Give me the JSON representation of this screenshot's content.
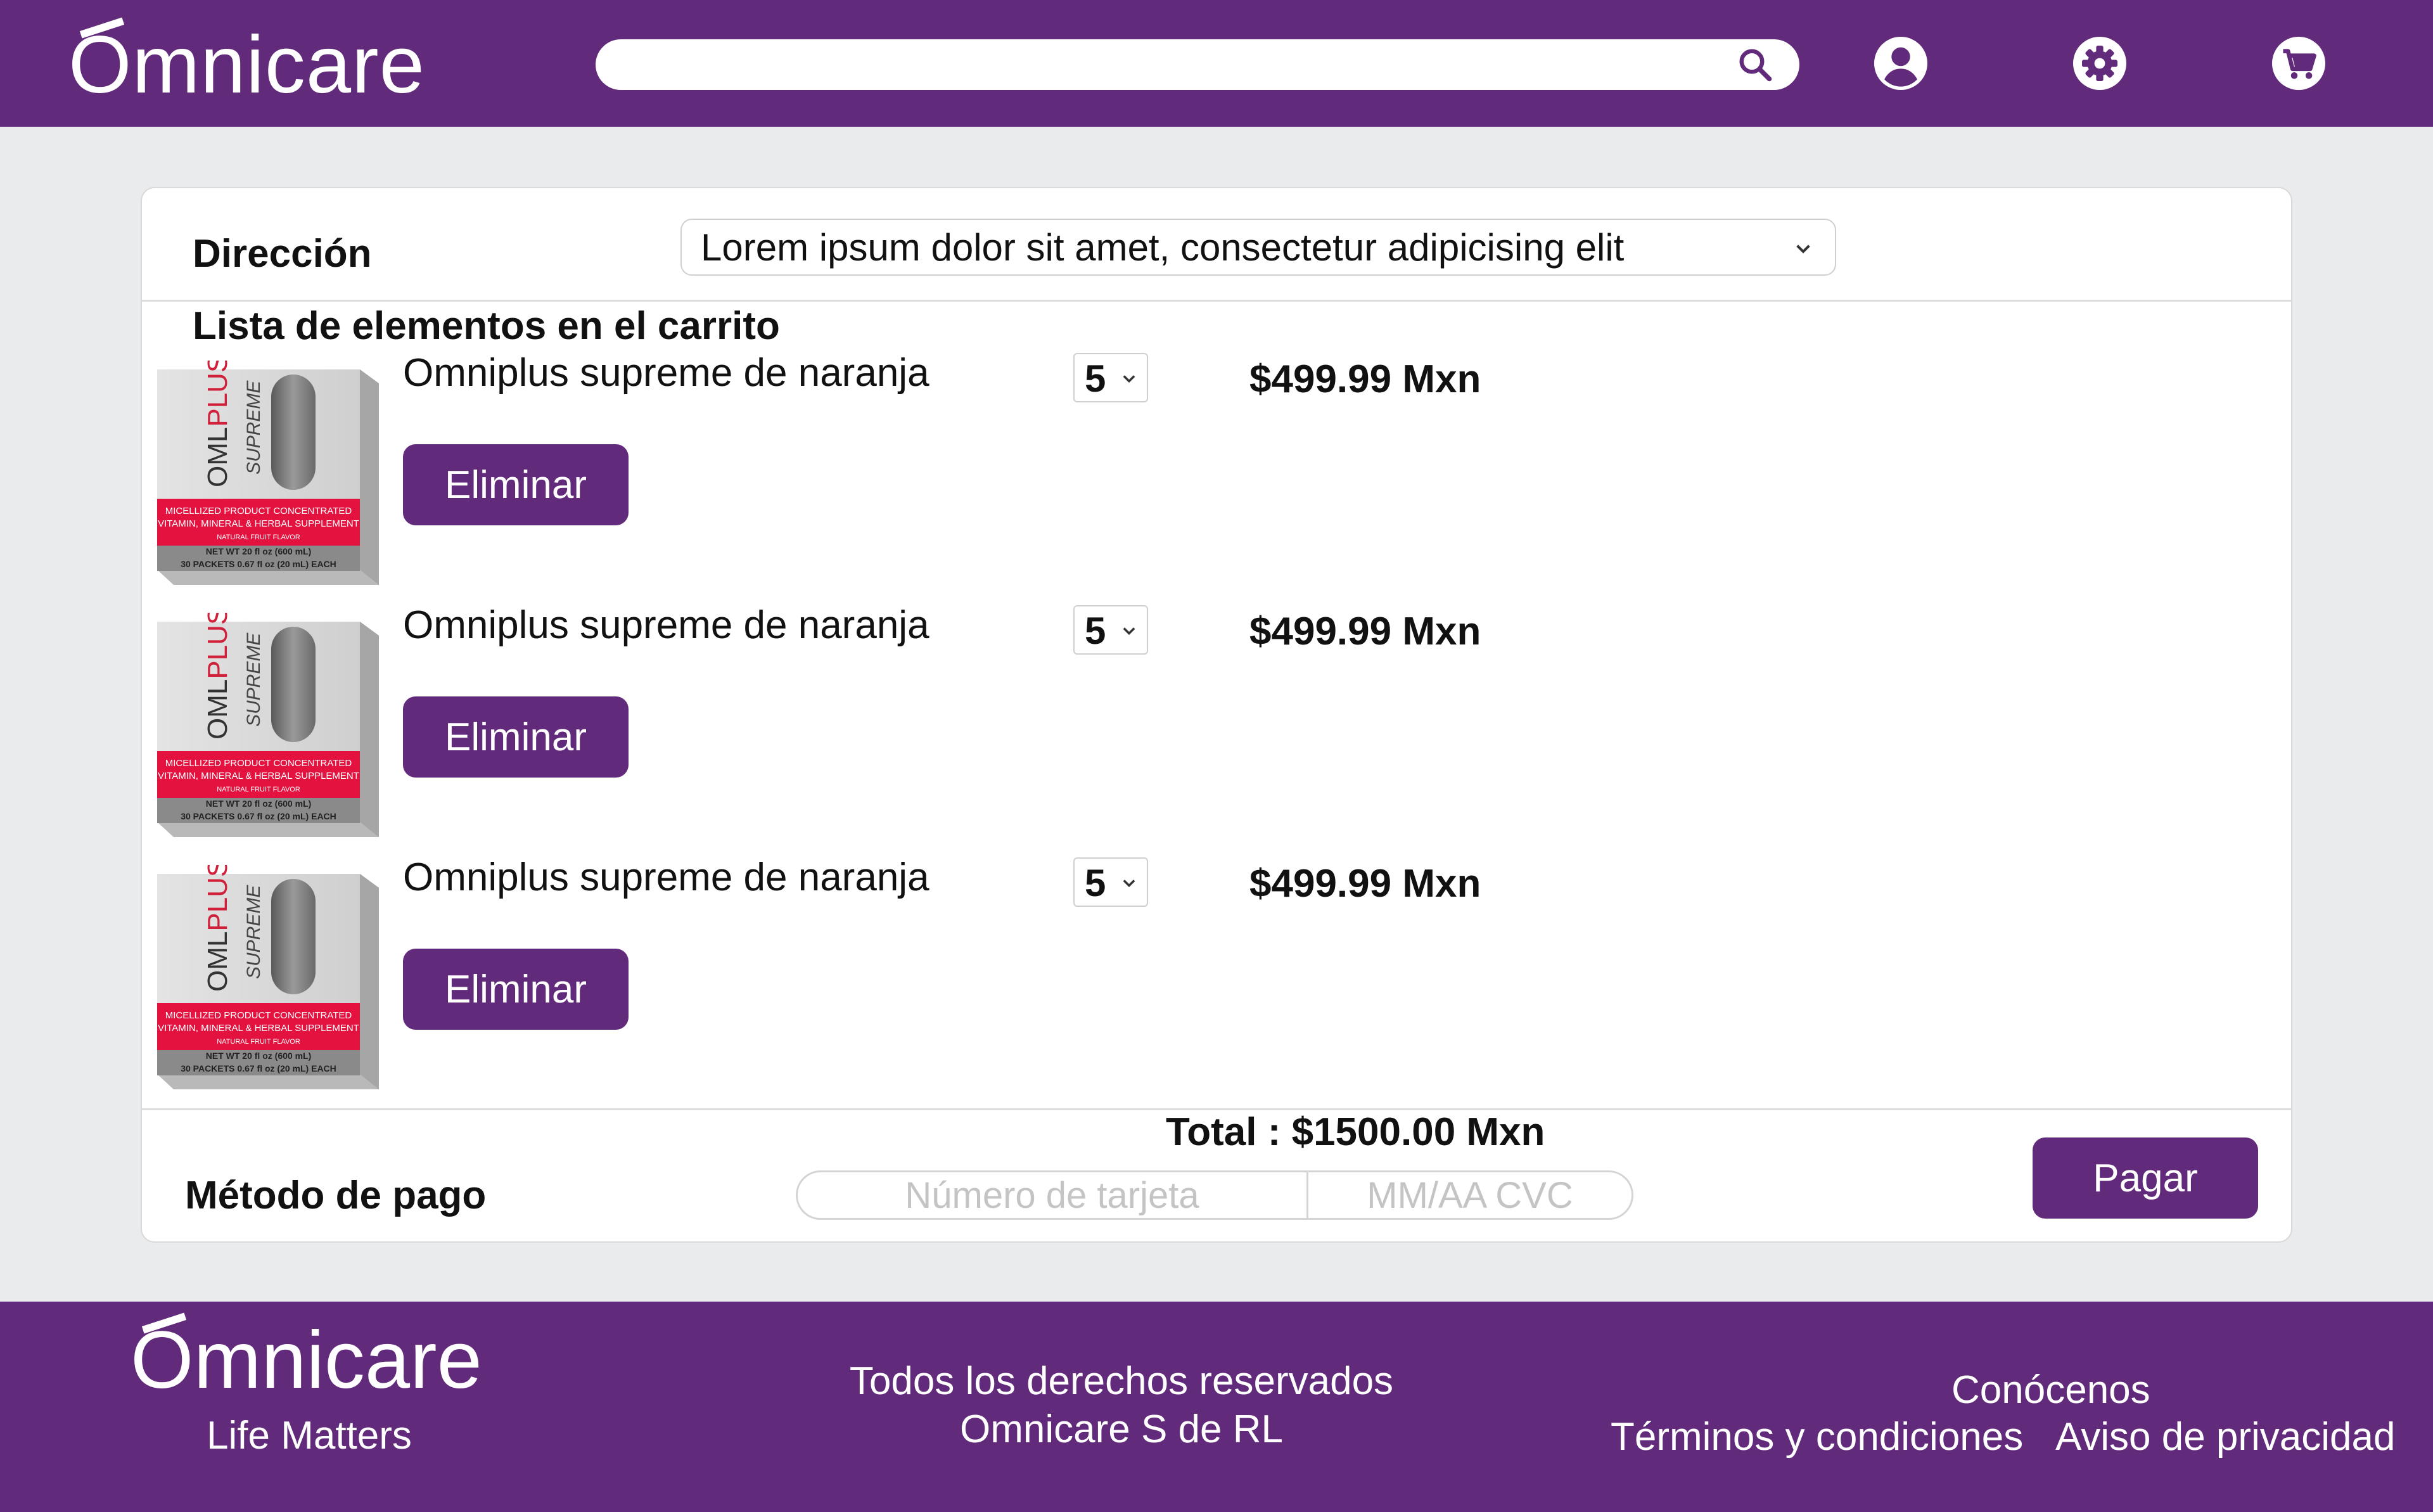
{
  "brand": {
    "logo_text": "mnicare",
    "primary_color": "#612a7b"
  },
  "header": {
    "search": {
      "placeholder": "",
      "icon": "search-icon"
    },
    "icons": [
      "user-icon",
      "gear-icon",
      "cart-icon"
    ]
  },
  "cart": {
    "address_label": "Dirección",
    "address_value": "Lorem ipsum dolor sit amet, consectetur adipicising elit",
    "list_title": "Lista de elementos en el carrito",
    "items": [
      {
        "name": "Omniplus supreme de naranja",
        "quantity": "5",
        "price": "$499.99 Mxn",
        "delete_label": "Eliminar"
      },
      {
        "name": "Omniplus supreme de naranja",
        "quantity": "5",
        "price": "$499.99 Mxn",
        "delete_label": "Eliminar"
      },
      {
        "name": "Omniplus supreme de naranja",
        "quantity": "5",
        "price": "$499.99 Mxn",
        "delete_label": "Eliminar"
      }
    ],
    "product_image": {
      "brand_left": "OML",
      "brand_right": "PLUS",
      "sub": "SUPREME",
      "band_line1": "MICELLIZED PRODUCT CONCENTRATED",
      "band_line2": "VITAMIN, MINERAL & HERBAL SUPPLEMENT",
      "band_line3": "NATURAL FRUIT FLAVOR",
      "net_line1": "NET WT 20 fl oz (600 mL)",
      "net_line2": "30 PACKETS 0.67 fl oz (20 mL) EACH"
    },
    "total": "Total : $1500.00 Mxn",
    "payment_label": "Método de pago",
    "card_number_placeholder": "Número de tarjeta",
    "card_expiry_placeholder": "MM/AA CVC",
    "pay_label": "Pagar"
  },
  "footer": {
    "logo_text": "mnicare",
    "tagline": "Life Matters",
    "rights_line1": "Todos los derechos reservados",
    "rights_line2": "Omnicare S de RL",
    "links": {
      "about": "Conócenos",
      "terms": "Términos y condiciones",
      "privacy": "Aviso de privacidad"
    }
  }
}
